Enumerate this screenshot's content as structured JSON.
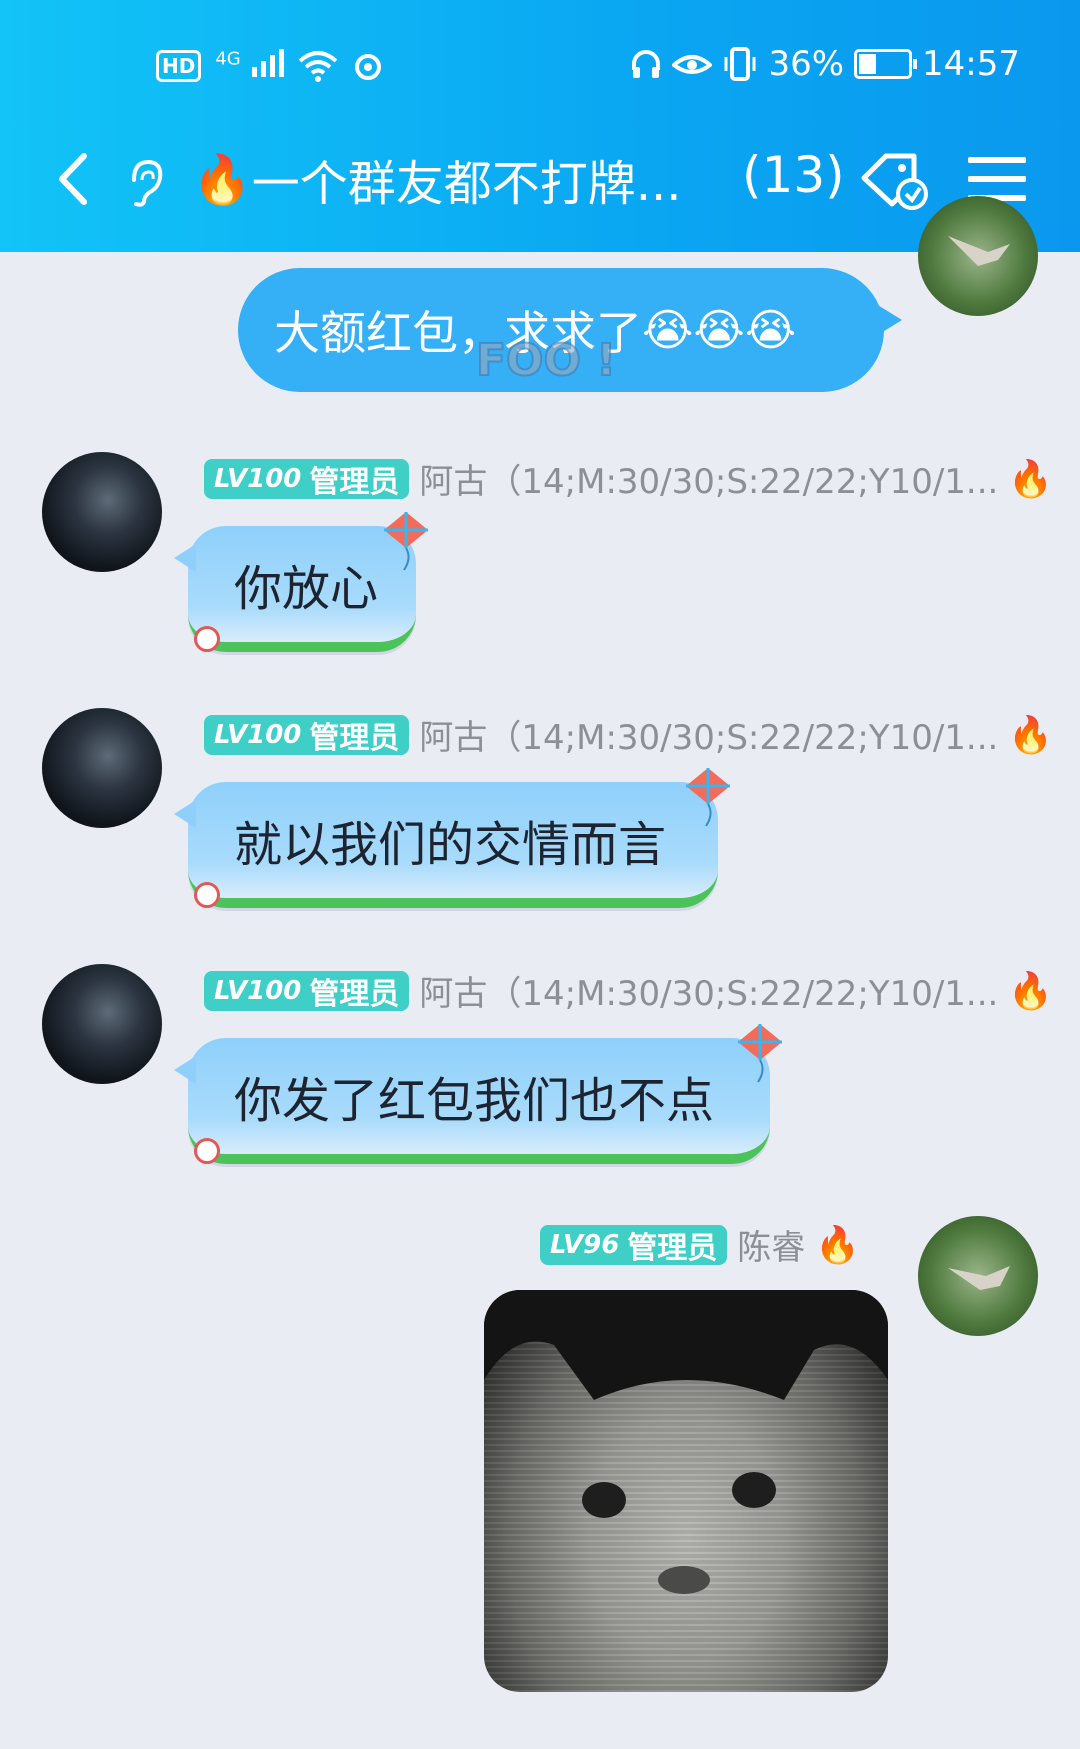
{
  "status_bar": {
    "hd": "HD",
    "network": "4G",
    "battery_percent": "36%",
    "battery_level": 0.36,
    "time": "14:57"
  },
  "header": {
    "title": "一个群友都不打牌...",
    "member_count": "(13)",
    "title_emoji": "🔥"
  },
  "messages": [
    {
      "side": "right",
      "text": "大额红包，求求了",
      "emojis": "😭😭😭",
      "overlay": "FOO !"
    },
    {
      "side": "left",
      "level": "LV100",
      "role": "管理员",
      "sender": "阿古（14;M:30/30;S:22/22;Y10/1...",
      "flame": "🔥",
      "text": "你放心"
    },
    {
      "side": "left",
      "level": "LV100",
      "role": "管理员",
      "sender": "阿古（14;M:30/30;S:22/22;Y10/1...",
      "flame": "🔥",
      "text": "就以我们的交情而言"
    },
    {
      "side": "left",
      "level": "LV100",
      "role": "管理员",
      "sender": "阿古（14;M:30/30;S:22/22;Y10/1...",
      "flame": "🔥",
      "text": "你发了红包我们也不点"
    },
    {
      "side": "right",
      "level": "LV96",
      "role": "管理员",
      "sender": "陈睿",
      "flame": "🔥",
      "image": "sad-cat-sticker"
    }
  ],
  "colors": {
    "header_start": "#12c4f7",
    "header_end": "#0a98ee",
    "my_bubble": "#35aff5",
    "badge": "#3fcfc7",
    "background": "#e9ecf3"
  }
}
